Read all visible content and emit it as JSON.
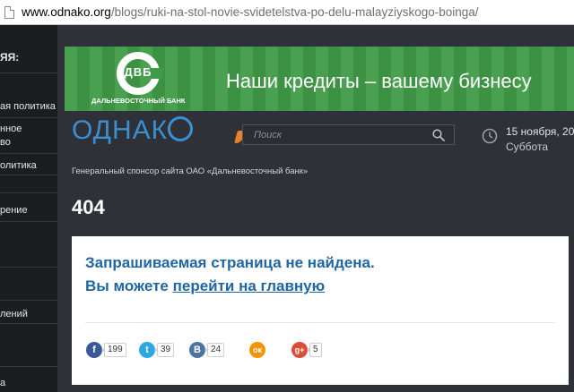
{
  "browser": {
    "url_host": "www.odnako.org",
    "url_path": "/blogs/ruki-na-stol-novie-svidetelstva-po-delu-malayziyskogo-boinga/"
  },
  "sidebar": {
    "items": [
      {
        "label": "ЯЯ:"
      },
      {
        "label": "ая политика"
      },
      {
        "label": "нное"
      },
      {
        "label": "во"
      },
      {
        "label": "олитика"
      },
      {
        "label": "рение"
      },
      {
        "label": "лений"
      },
      {
        "label": "а"
      }
    ]
  },
  "banner": {
    "bank_abbr": "ДВБ",
    "bank_name": "ДАЛЬНЕВОСТОЧНЫЙ БАНК",
    "slogan": "Наши кредиты – вашему бизнесу",
    "color": "#3f9a46"
  },
  "header": {
    "logo_text_before": "ОДНАК",
    "logo_accent": "#e8812c",
    "logo_color": "#3b8fd0",
    "search_placeholder": "Поиск",
    "date": "15 ноября, 20",
    "weekday": "Суббота",
    "sponsor": "Генеральный спонсор сайта ОАО «Дальневосточный банк»"
  },
  "main": {
    "error_code": "404",
    "message_line1": "Запрашиваемая страница не найдена.",
    "message_line2_prefix": "Вы можете ",
    "message_link": "перейти на главную"
  },
  "share": [
    {
      "network": "facebook",
      "icon": "f",
      "count": "199",
      "color": "#3b5998"
    },
    {
      "network": "twitter",
      "icon": "t",
      "count": "39",
      "color": "#2ca7e0"
    },
    {
      "network": "vkontakte",
      "icon": "В",
      "count": "24",
      "color": "#4c75a3"
    },
    {
      "network": "odnoklassniki",
      "icon": "ок",
      "count": "",
      "color": "#f39400"
    },
    {
      "network": "googleplus",
      "icon": "g+",
      "count": "5",
      "color": "#dd4b39"
    }
  ]
}
